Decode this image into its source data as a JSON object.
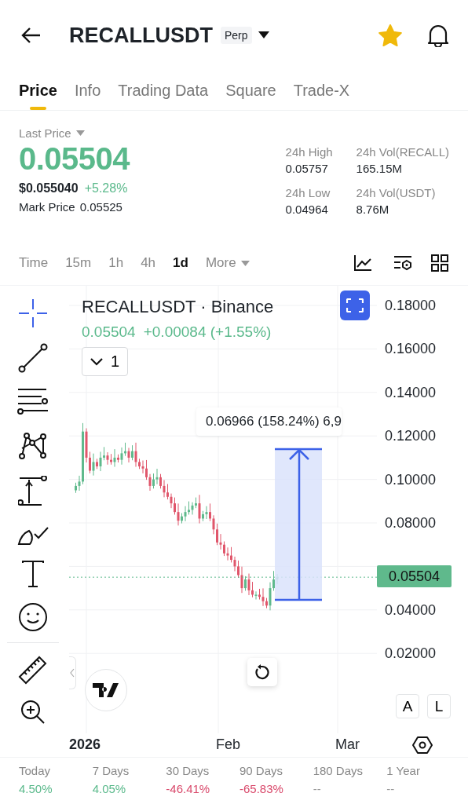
{
  "header": {
    "title": "RECALLUSDT",
    "badge": "Perp",
    "favorite": true
  },
  "tabs": [
    {
      "label": "Price",
      "selected": true
    },
    {
      "label": "Info",
      "selected": false
    },
    {
      "label": "Trading Data",
      "selected": false
    },
    {
      "label": "Square",
      "selected": false
    },
    {
      "label": "Trade-X",
      "selected": false
    }
  ],
  "price": {
    "label": "Last Price",
    "value": "0.05504",
    "usd": "$0.055040",
    "change": "+5.28%",
    "mark_label": "Mark Price",
    "mark_value": "0.05525"
  },
  "stats": [
    {
      "label": "24h High",
      "value": "0.05757"
    },
    {
      "label": "24h Vol(RECALL)",
      "value": "165.15M"
    },
    {
      "label": "24h Low",
      "value": "0.04964"
    },
    {
      "label": "24h Vol(USDT)",
      "value": "8.76M"
    }
  ],
  "intervals": [
    {
      "label": "Time",
      "selected": false
    },
    {
      "label": "15m",
      "selected": false
    },
    {
      "label": "1h",
      "selected": false
    },
    {
      "label": "4h",
      "selected": false
    },
    {
      "label": "1d",
      "selected": true
    },
    {
      "label": "More",
      "selected": false
    }
  ],
  "chart": {
    "symbol": "RECALLUSDT · Binance",
    "quote": "0.05504",
    "quote_change": "+0.00084 (+1.55%)",
    "indicator_count": "1",
    "measure": "0.06966 (158.24%) 6,9",
    "current_price": "0.05504",
    "price_axis": [
      "0.18000",
      "0.16000",
      "0.14000",
      "0.12000",
      "0.10000",
      "0.08000",
      "0.04000",
      "0.02000"
    ],
    "time_axis": [
      "2026",
      "Feb",
      "Mar"
    ],
    "scale_buttons": [
      "A",
      "L"
    ]
  },
  "performance": [
    {
      "label": "Today",
      "value": "4.50%",
      "color": "#5ab98b"
    },
    {
      "label": "7 Days",
      "value": "4.05%",
      "color": "#5ab98b"
    },
    {
      "label": "30 Days",
      "value": "-46.41%",
      "color": "#d9496b"
    },
    {
      "label": "90 Days",
      "value": "-65.83%",
      "color": "#d9496b"
    },
    {
      "label": "180 Days",
      "value": "--",
      "color": "#999999"
    },
    {
      "label": "1 Year",
      "value": "--",
      "color": "#999999"
    }
  ]
}
